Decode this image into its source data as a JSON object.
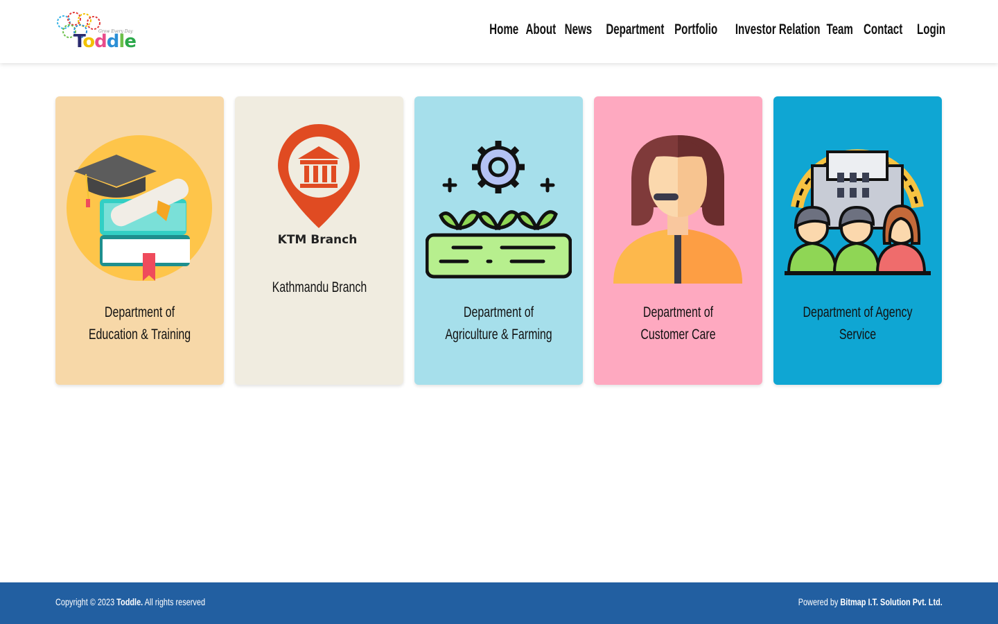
{
  "header": {
    "logo": {
      "text": "Toddle",
      "tagline": "Grow Every Day"
    },
    "nav": [
      "Home",
      "About",
      "News",
      "Department",
      "Portfolio",
      "Investor Relation",
      "Team",
      "Contact",
      "Login"
    ]
  },
  "cards": [
    {
      "title": "Department of Education & Training",
      "bg": "#f7d8a8",
      "icon": "graduation-books-icon"
    },
    {
      "title": "Kathmandu Branch",
      "bg": "#f0ece0",
      "icon": "ktm-branch-pin-icon",
      "icon_text": "KTM Branch"
    },
    {
      "title": "Department of Agriculture & Farming",
      "bg": "#a6dfeb",
      "icon": "agriculture-plants-gear-icon"
    },
    {
      "title": "Department of Customer Care",
      "bg": "#fea9c0",
      "icon": "customer-care-agent-icon"
    },
    {
      "title": "Department of Agency Service",
      "bg": "#0fa6d3",
      "icon": "agency-building-people-icon"
    }
  ],
  "footer": {
    "copyright_prefix": "Copyright © 2023",
    "brand": "Toddle.",
    "rights": "All rights reserved",
    "powered_prefix": "Powered by",
    "powered_company": "Bitmap I.T. Solution Pvt. Ltd."
  },
  "colors": {
    "footer_bg": "#225fa1"
  }
}
